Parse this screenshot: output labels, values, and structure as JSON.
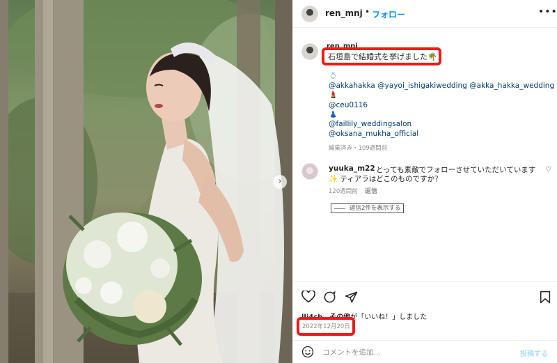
{
  "header": {
    "username": "ren_mnj",
    "separator": "•",
    "follow_label": "フォロー",
    "more_label": "•••"
  },
  "caption": {
    "username": "ren_mnj",
    "title": "石垣島で結婚式を挙げました🌴",
    "lines": [
      {
        "emoji": "💍",
        "text": "@akkahakka @yayoi_ishigakiwedding @akka_hakka_wedding"
      },
      {
        "emoji": "💄",
        "text": "@ceu0116"
      },
      {
        "emoji": "👗",
        "text": "@faillily_weddingsalon"
      },
      {
        "emoji": "",
        "text": "@oksana_mukha_official"
      }
    ],
    "meta": "編集済み・109週間前"
  },
  "comment": {
    "username": "yuuka_m22",
    "text_line1": "とっても素敵でフォローさせていただいています",
    "text_line2": "✨ ティアラはどこのものですか？",
    "time": "120週間前",
    "reply_label": "返信",
    "view_replies_label": "返信2件を表示する",
    "heart": "♡"
  },
  "likes": {
    "prefix": "lli4ch、その他",
    "suffix": "が「いいね！」しました"
  },
  "date": "2022年12月20日",
  "comment_bar": {
    "placeholder": "コメントを追加...",
    "post_label": "投稿する"
  },
  "photo": {
    "next_arrow": "›"
  },
  "colors": {
    "accent_blue": "#0095f6",
    "highlight_red": "#ee1b1b",
    "muted": "#8e8e8e"
  }
}
